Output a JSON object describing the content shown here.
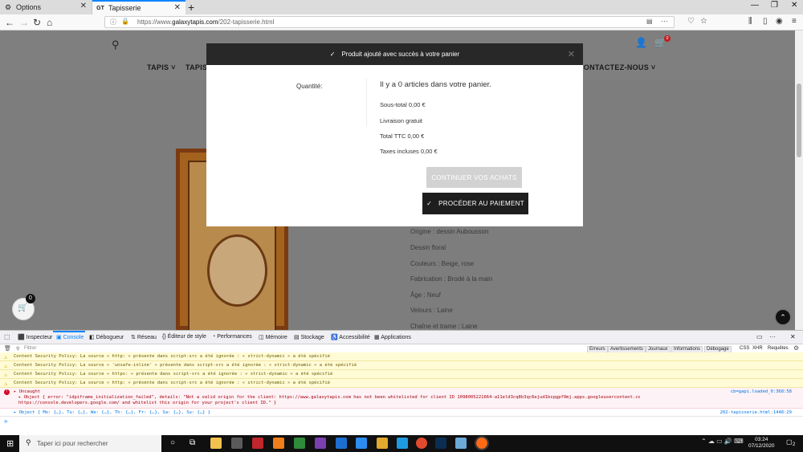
{
  "browser": {
    "tabs": [
      {
        "label": "Options",
        "icon": "gear-icon"
      },
      {
        "label": "Tapisserie",
        "icon": "site-favicon",
        "favicon_text": "GT"
      }
    ],
    "new_tab": "+",
    "url_prefix": "https://www.",
    "url_domain": "galaxytapis.com",
    "url_path": "/202-tapisserie.html",
    "menu_dots": "···"
  },
  "site": {
    "menu": [
      "TAPIS ˅",
      "TAPIS",
      "CONTACTEZ-NOUS ˅"
    ],
    "cart_count": "0",
    "floating_cart_count": "0",
    "description_lines": [
      "Origine : dessin Aubousson",
      "Dessin floral",
      "Couleurs : Beige, rose",
      "Fabrication : Brodé à la main",
      "Âge : Neuf",
      "Velours : Laine",
      "Chaîne et trame : Laine"
    ]
  },
  "modal": {
    "header": "Produit ajouté avec succès à votre panier",
    "quantity_label": "Quantité:",
    "cart_count_text": "Il y a 0 articles dans votre panier.",
    "subtotal": "Sous-total 0,00 €",
    "shipping": "Livraison gratuit",
    "total": "Total TTC 0,00 €",
    "taxes": "Taxes incluses 0,00 €",
    "continue_label": "CONTINUER VOS ACHATS",
    "checkout_label": "PROCÉDER AU PAIEMENT"
  },
  "devtools": {
    "tabs": [
      "Inspecteur",
      "Console",
      "Débogueur",
      "Réseau",
      "Éditeur de style",
      "Performances",
      "Mémoire",
      "Stockage",
      "Accessibilité",
      "Applications"
    ],
    "selected_tab": "Console",
    "filter_placeholder": "Filtrer",
    "filter_buttons": [
      "Erreurs",
      "Avertissements",
      "Journaux",
      "Informations",
      "Débogage"
    ],
    "filter_extras": [
      "CSS",
      "XHR",
      "Requêtes"
    ],
    "warnings": [
      "Content Security Policy: La source « http: » présente dans script-src a été ignorée : « strict-dynamic » a été spécifié",
      "Content Security Policy: La source « 'unsafe-inline' » présente dans script-src a été ignorée : « strict-dynamic » a été spécifié",
      "Content Security Policy: La source « https: » présente dans script-src a été ignorée : « strict-dynamic » a été spécifié",
      "Content Security Policy: La source « http: » présente dans script-src a été ignorée : « strict-dynamic » a été spécifié"
    ],
    "error_title": "▸ Uncaught",
    "error_line1": "▸ Object { error: \"idpiframe_initialization_failed\", details: \"Not a valid origin for the client: https://www.galaxytapis.com has not been whitelisted for client ID 1098005221664-a11eld3cq8b3qc6ejud1bspgpf9mj.apps.googleusercontent.com. Please go to",
    "error_line2": "https://console.developers.google.com/ and whitelist this origin for your project's client ID.\" }",
    "error_source": "cb=gapi.loaded_0:368:58",
    "object_line": "▸ Object { Mo: {…}, Tu: {…}, We: {…}, Th: {…}, Fr: {…}, Sa: {…}, Su: {…} }",
    "object_source": "202-tapisserie.html:1448:29",
    "prompt": "»"
  },
  "taskbar": {
    "search_placeholder": "Taper ici pour rechercher",
    "time": "03:24",
    "date": "07/12/2020",
    "notification_count": "2"
  }
}
